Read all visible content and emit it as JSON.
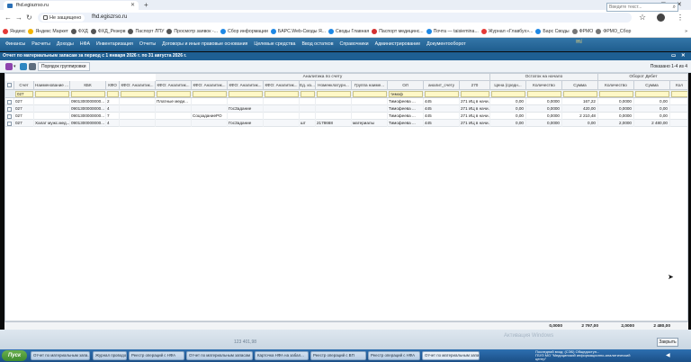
{
  "browser": {
    "tab_title": "fhd.egiszrso.ru",
    "new_tab": "+",
    "minimize": "—",
    "maximize": "▢",
    "close": "✕",
    "back": "←",
    "forward": "→",
    "reload": "↻",
    "secure_label": "Не защищено",
    "url": "fhd.egiszrso.ru",
    "star": "☆",
    "kebab": "⋮"
  },
  "bookmarks": [
    {
      "label": "Яндекс",
      "color": "#e53935"
    },
    {
      "label": "Яндекс Маркет",
      "color": "#f4b400"
    },
    {
      "label": "ФХД",
      "color": "#555555"
    },
    {
      "label": "ФХД_Резерв",
      "color": "#555555"
    },
    {
      "label": "Паспорт ЛПУ",
      "color": "#555555"
    },
    {
      "label": "Просмотр заявок -...",
      "color": "#555555"
    },
    {
      "label": "Сбор информации",
      "color": "#1e88e5"
    },
    {
      "label": "БАРС.Web-Своды Я...",
      "color": "#1e88e5"
    },
    {
      "label": "Своды Главная",
      "color": "#1e88e5"
    },
    {
      "label": "Паспорт медицинс...",
      "color": "#d32f2f"
    },
    {
      "label": "Почта — taisiemina...",
      "color": "#1e88e5"
    },
    {
      "label": "Журнал «Главбух»...",
      "color": "#e53935"
    },
    {
      "label": "Барс Своды",
      "color": "#1e88e5"
    },
    {
      "label": "ФРМО",
      "color": "#777777"
    },
    {
      "label": "ФРМО_Сбор",
      "color": "#777777"
    }
  ],
  "bookmarks_more": "»",
  "app_menu": [
    "Финансы",
    "Расчеты",
    "Доходы",
    "НФА",
    "Инвентаризация",
    "Отчеты",
    "Договоры и иные правовые основания",
    "Целевые средства",
    "Ввод остатков",
    "Справочники",
    "Администрирование",
    "Документооборот"
  ],
  "app_search_placeholder": "Введите текст...",
  "app_search_icon": "⌕",
  "logo_text": "✉ⅈ",
  "report": {
    "title": "Отчет по материальным запасам за период с 1 января 2026 г. по 31 августа 2026 г.",
    "controls": [
      "▭",
      "✕"
    ],
    "group_button": "Порядок группировки",
    "shown": "Показано 1-4 из 4"
  },
  "grid": {
    "group_headers": {
      "analytics": "Аналитика по счету",
      "opening": "Остаток на начало",
      "debit": "Оборот Дебет"
    },
    "columns": [
      "",
      "Счет",
      "Наименование ...",
      "КБК",
      "КФО",
      "КФО: Аналитик...",
      "КФО: Аналитик...",
      "КФО: Аналитик...",
      "КФО: Аналитик...",
      "КФО: Аналитик...",
      "Ед. из...",
      "Номенклатурн...",
      "Группа наиме...",
      "ОЛ",
      "аналит_счету",
      "270",
      "Цена (средн...",
      "Количество",
      "Сумма",
      "Количество",
      "Сумма",
      "Кол"
    ],
    "filters": [
      "",
      "027",
      "",
      "",
      "",
      "",
      "",
      "",
      "",
      "",
      "",
      "",
      "",
      "тимоф",
      "",
      "",
      "",
      "",
      "",
      "",
      "",
      ""
    ],
    "rows": [
      [
        "",
        "027",
        "",
        "0901300000000...",
        "2",
        "",
        "Платные меди...",
        "",
        "",
        "",
        "",
        "",
        "",
        "Тимофеева ...",
        "445",
        "271 ИЦ в начи...",
        "0,00",
        "0,0000",
        "167,22",
        "0,0000",
        "0,00",
        ""
      ],
      [
        "",
        "027",
        "",
        "0901300000000...",
        "4",
        "",
        "",
        "",
        "ГосЗадание",
        "",
        "",
        "",
        "",
        "Тимофеева ...",
        "445",
        "271 ИЦ в начи...",
        "0,00",
        "0,0000",
        "420,00",
        "0,0000",
        "0,00",
        ""
      ],
      [
        "",
        "027",
        "",
        "0901300000000...",
        "7",
        "",
        "",
        "СоцзаданиеРО",
        "",
        "",
        "",
        "",
        "",
        "Тимофеева ...",
        "445",
        "271 ИЦ в начи...",
        "0,00",
        "0,0000",
        "2 210,48",
        "0,0000",
        "0,00",
        ""
      ],
      [
        "",
        "027",
        "Халат мужс.мед...",
        "0901300000000...",
        "4",
        "",
        "",
        "",
        "ГосЗадание",
        "",
        "шт",
        "2178668",
        "материалы",
        "Тимофеева ...",
        "445",
        "271 ИЦ в начи...",
        "0,00",
        "0,0000",
        "0,00",
        "2,0000",
        "2 480,00",
        ""
      ]
    ],
    "totals": [
      "0,0000",
      "2 797,00",
      "2,0000",
      "2 480,00"
    ]
  },
  "bottom": {
    "close_button": "Закрыть",
    "status_under": "123 401,98",
    "activate": "Активация Windows"
  },
  "taskbar": {
    "start": "Пуск",
    "tasks": [
      {
        "label": "Отчет по материальным запа...",
        "active": false
      },
      {
        "label": "Журнал проводок",
        "active": false
      },
      {
        "label": "Реестр операций с НФА",
        "active": false
      },
      {
        "label": "Отчет по материальным запасам",
        "active": false
      },
      {
        "label": "Карточка НФА на забал...",
        "active": false
      },
      {
        "label": "Реестр операций с ВП",
        "active": false
      },
      {
        "label": "Реестр операций с НФА",
        "active": false
      },
      {
        "label": "Отчет по материальным запа...",
        "active": true
      }
    ],
    "tray_lines": [
      "Последний вход: (СЭБ) Общедоступ...",
      "ГБУЗ МО \"Медицинский информационно-аналитический",
      "центр\""
    ],
    "tray_arrow": "◀"
  },
  "colors": {
    "menu_bg": "#1f5d8e",
    "title_bg": "#1e5f93",
    "filter_bg": "#fff8c7",
    "taskbar": "#1b4f86"
  }
}
